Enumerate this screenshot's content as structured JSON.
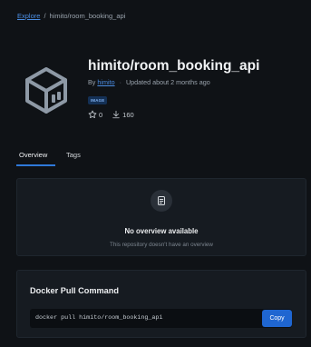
{
  "breadcrumb": {
    "explore_label": "Explore",
    "separator": "/",
    "current": "himito/room_booking_api"
  },
  "repo": {
    "title": "himito/room_booking_api",
    "by_label": "By",
    "author": "himito",
    "updated": "Updated about 2 months ago",
    "type_badge": "IMAGE",
    "stars": "0",
    "pulls": "160",
    "icon": "docker-cube-icon"
  },
  "tabs": [
    {
      "label": "Overview",
      "active": true
    },
    {
      "label": "Tags",
      "active": false
    }
  ],
  "overview": {
    "icon": "document-icon",
    "title": "No overview available",
    "subtitle": "This repository doesn't have an overview"
  },
  "pull": {
    "title": "Docker Pull Command",
    "command": "docker pull himito/room_booking_api",
    "copy_label": "Copy"
  },
  "colors": {
    "background": "#0f1216",
    "accent": "#2f79d9",
    "link": "#4b8de3",
    "card": "#161b21"
  }
}
